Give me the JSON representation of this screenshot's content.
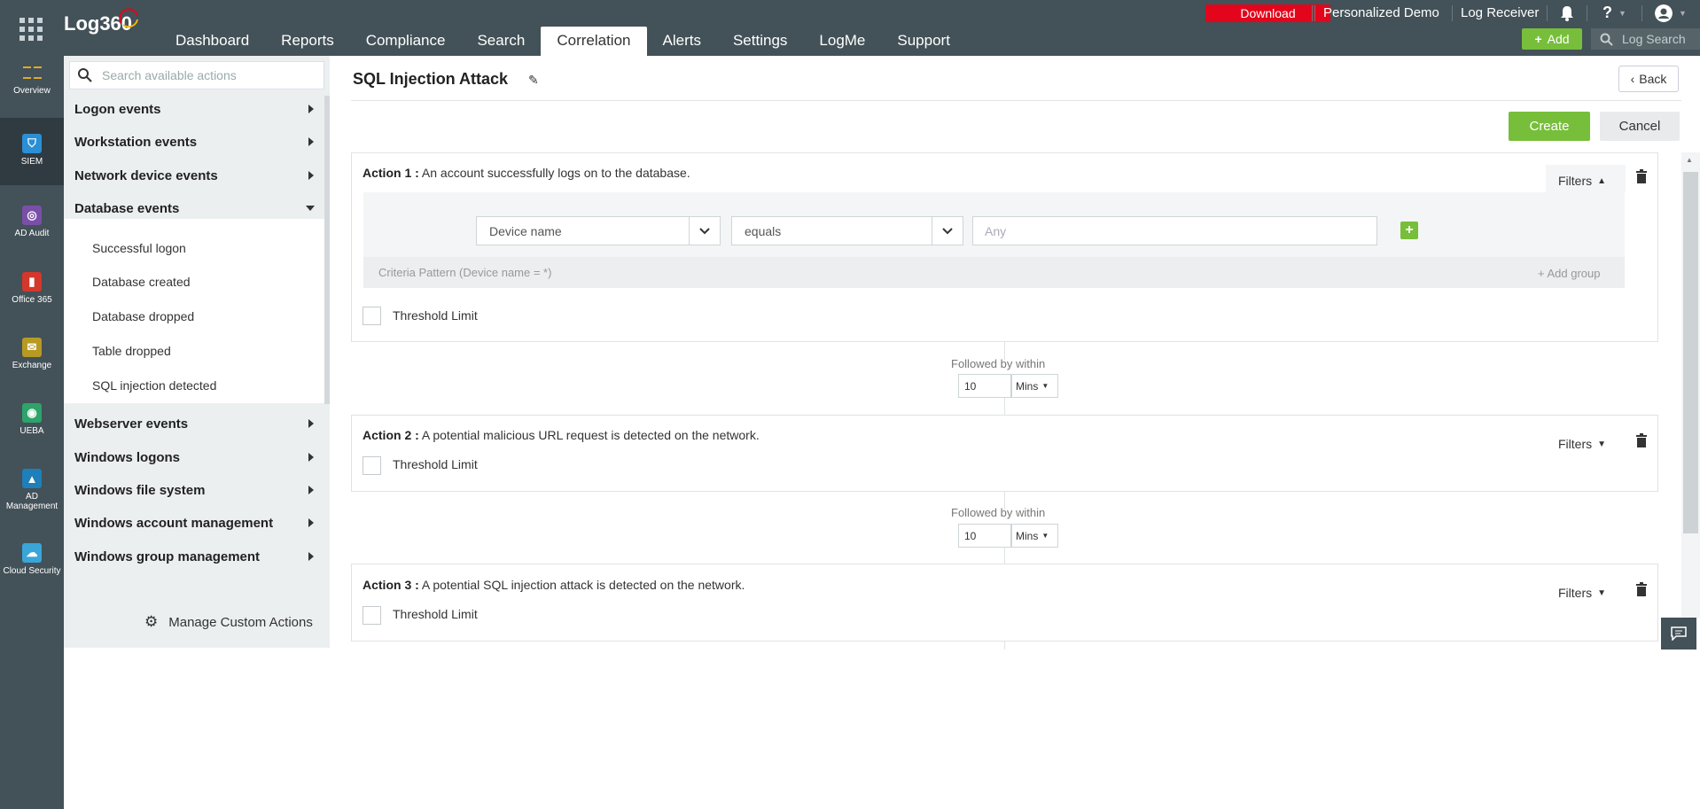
{
  "app": {
    "logo": "Log360"
  },
  "nav": {
    "items": [
      "Dashboard",
      "Reports",
      "Compliance",
      "Search",
      "Correlation",
      "Alerts",
      "Settings",
      "LogMe",
      "Support"
    ],
    "active": "Correlation"
  },
  "topright": {
    "download": "Download",
    "demo": "Personalized Demo",
    "receiver": "Log Receiver",
    "help": "?",
    "add": "Add",
    "logsearch": "Log Search"
  },
  "leftnav": [
    "Overview",
    "SIEM",
    "AD Audit",
    "Office 365",
    "Exchange",
    "UEBA",
    "AD Management",
    "Cloud Security"
  ],
  "side": {
    "search_placeholder": "Search available actions",
    "categories": [
      "Logon events",
      "Workstation events",
      "Network device events",
      "Database events",
      "Webserver events",
      "Windows logons",
      "Windows file system",
      "Windows account management",
      "Windows group management"
    ],
    "db_actions": [
      "Successful logon",
      "Database created",
      "Database dropped",
      "Table dropped",
      "SQL injection detected"
    ],
    "manage": "Manage Custom Actions"
  },
  "page": {
    "title": "SQL Injection Attack",
    "back": "Back",
    "create": "Create",
    "cancel": "Cancel"
  },
  "actions": [
    {
      "label": "Action 1 :",
      "desc": "An account successfully logs on to the database.",
      "filters": "Filters",
      "threshold": "Threshold Limit"
    },
    {
      "label": "Action 2 :",
      "desc": "A potential malicious URL request is detected on the network.",
      "filters": "Filters",
      "threshold": "Threshold Limit"
    },
    {
      "label": "Action 3 :",
      "desc": "A potential SQL injection attack is detected on the network.",
      "filters": "Filters",
      "threshold": "Threshold Limit"
    }
  ],
  "criteria": {
    "field": "Device name",
    "op": "equals",
    "value_placeholder": "Any",
    "pattern": "Criteria Pattern (Device name = *)",
    "add_group": "Add group"
  },
  "followed": {
    "label": "Followed by within",
    "value": "10",
    "unit": "Mins"
  }
}
